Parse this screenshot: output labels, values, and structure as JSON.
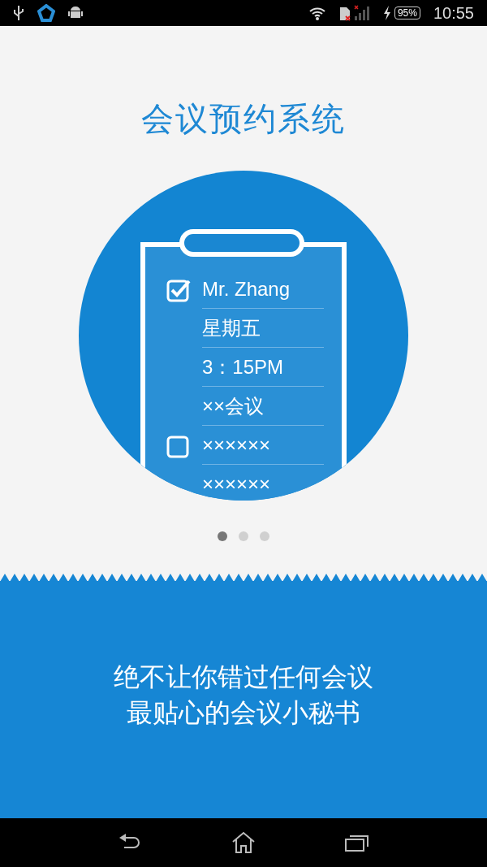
{
  "status_bar": {
    "battery": "95%",
    "time": "10:55"
  },
  "title": "会议预约系统",
  "clipboard": {
    "rows": [
      {
        "kind": "checkbox",
        "checked": true,
        "text": "Mr. Zhang"
      },
      {
        "kind": "text",
        "text": "星期五"
      },
      {
        "kind": "text",
        "text": "3：15PM"
      },
      {
        "kind": "text",
        "text": "××会议"
      },
      {
        "kind": "checkbox",
        "checked": false,
        "text": "××××××"
      },
      {
        "kind": "text",
        "text": "××××××"
      }
    ]
  },
  "pager": [
    {
      "selected": true
    },
    {
      "selected": false
    },
    {
      "selected": false
    }
  ],
  "tagline": [
    "绝不让你错过任何会议",
    "最贴心的会议小秘书"
  ]
}
